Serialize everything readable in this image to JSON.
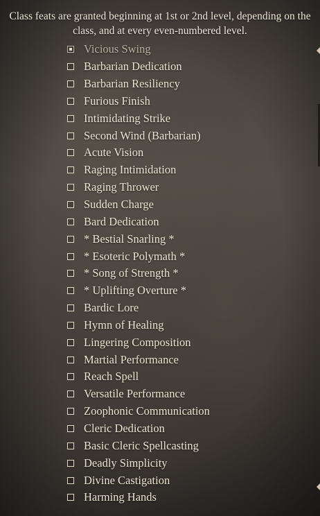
{
  "header": {
    "description": "Class feats are granted beginning at 1st or 2nd level, depending on the class, and at every even-numbered level."
  },
  "feats": [
    {
      "label": "Vicious Swing",
      "checked": true,
      "faded": true
    },
    {
      "label": "Barbarian Dedication",
      "checked": false
    },
    {
      "label": "Barbarian Resiliency",
      "checked": false
    },
    {
      "label": "Furious Finish",
      "checked": false
    },
    {
      "label": "Intimidating Strike",
      "checked": false
    },
    {
      "label": "Second Wind (Barbarian)",
      "checked": false
    },
    {
      "label": "Acute Vision",
      "checked": false
    },
    {
      "label": "Raging Intimidation",
      "checked": false
    },
    {
      "label": "Raging Thrower",
      "checked": false
    },
    {
      "label": "Sudden Charge",
      "checked": false
    },
    {
      "label": "Bard Dedication",
      "checked": false
    },
    {
      "label": "* Bestial Snarling *",
      "checked": false
    },
    {
      "label": "* Esoteric Polymath *",
      "checked": false
    },
    {
      "label": "* Song of Strength *",
      "checked": false
    },
    {
      "label": "* Uplifting Overture *",
      "checked": false
    },
    {
      "label": "Bardic Lore",
      "checked": false
    },
    {
      "label": "Hymn of Healing",
      "checked": false
    },
    {
      "label": "Lingering Composition",
      "checked": false
    },
    {
      "label": "Martial Performance",
      "checked": false
    },
    {
      "label": "Reach Spell",
      "checked": false
    },
    {
      "label": "Versatile Performance",
      "checked": false
    },
    {
      "label": "Zoophonic Communication",
      "checked": false
    },
    {
      "label": "Cleric Dedication",
      "checked": false
    },
    {
      "label": "Basic Cleric Spellcasting",
      "checked": false
    },
    {
      "label": "Deadly Simplicity",
      "checked": false
    },
    {
      "label": "Divine Castigation",
      "checked": false
    },
    {
      "label": "Harming Hands",
      "checked": false
    }
  ]
}
